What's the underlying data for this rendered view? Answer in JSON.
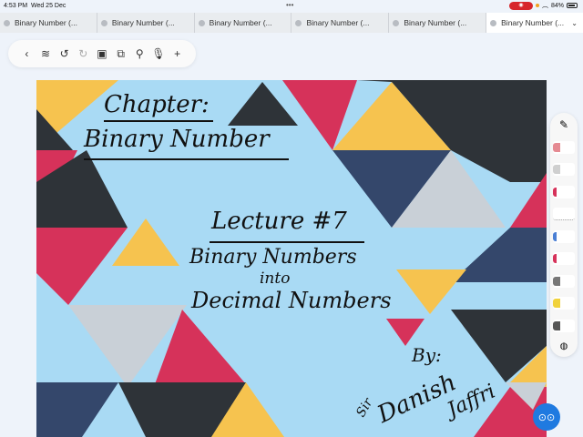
{
  "status": {
    "time": "4:53 PM",
    "date": "Wed 25 Dec",
    "battery": "84%",
    "dots": "•••"
  },
  "tabs": [
    {
      "label": "Binary Number (..."
    },
    {
      "label": "Binary Number (..."
    },
    {
      "label": "Binary Number (..."
    },
    {
      "label": "Binary Number (..."
    },
    {
      "label": "Binary Number (..."
    },
    {
      "label": "Binary Number (...",
      "active": true
    }
  ],
  "toolbar": {
    "icons": [
      "back-icon",
      "layers-icon",
      "undo-icon",
      "redo-icon",
      "page-icon",
      "shapes-icon",
      "search-icon",
      "mic-icon",
      "add-icon"
    ]
  },
  "slide": {
    "chapter": "Chapter:",
    "title": "Binary Number",
    "lecture": "Lecture #7",
    "line1": "Binary Numbers",
    "line2": "into",
    "line3": "Decimal Numbers",
    "by": "By:",
    "author1": "Danish",
    "author2": "Jaffri",
    "prefix": "Sir"
  },
  "colors": {
    "bg": "#a9daf4",
    "dark": "#2e3338",
    "red": "#d6325a",
    "yellow": "#f6c34f",
    "navy": "#34476b",
    "grey": "#c9d0d7"
  }
}
